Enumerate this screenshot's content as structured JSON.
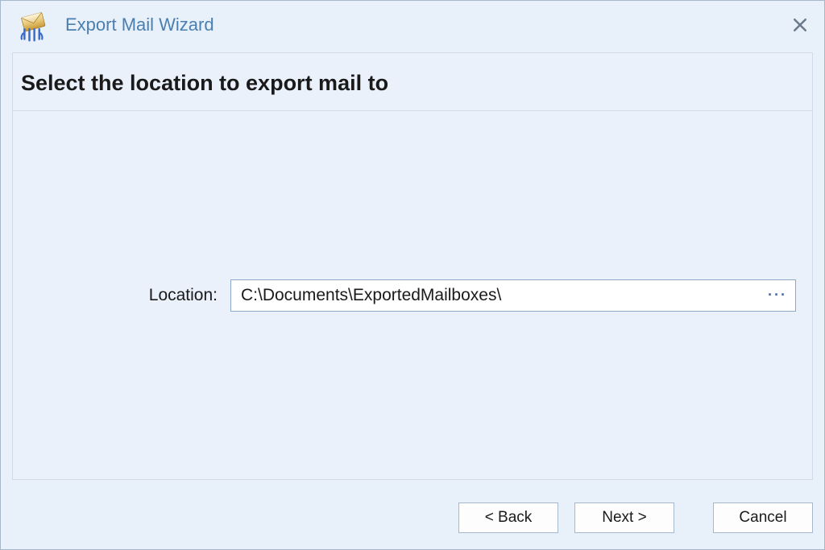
{
  "titlebar": {
    "title": "Export Mail Wizard"
  },
  "content": {
    "heading": "Select the location to export mail to",
    "location_label": "Location:",
    "location_value": "C:\\Documents\\ExportedMailboxes\\",
    "browse_dots": "···"
  },
  "buttons": {
    "back": "< Back",
    "next": "Next >",
    "cancel": "Cancel"
  }
}
